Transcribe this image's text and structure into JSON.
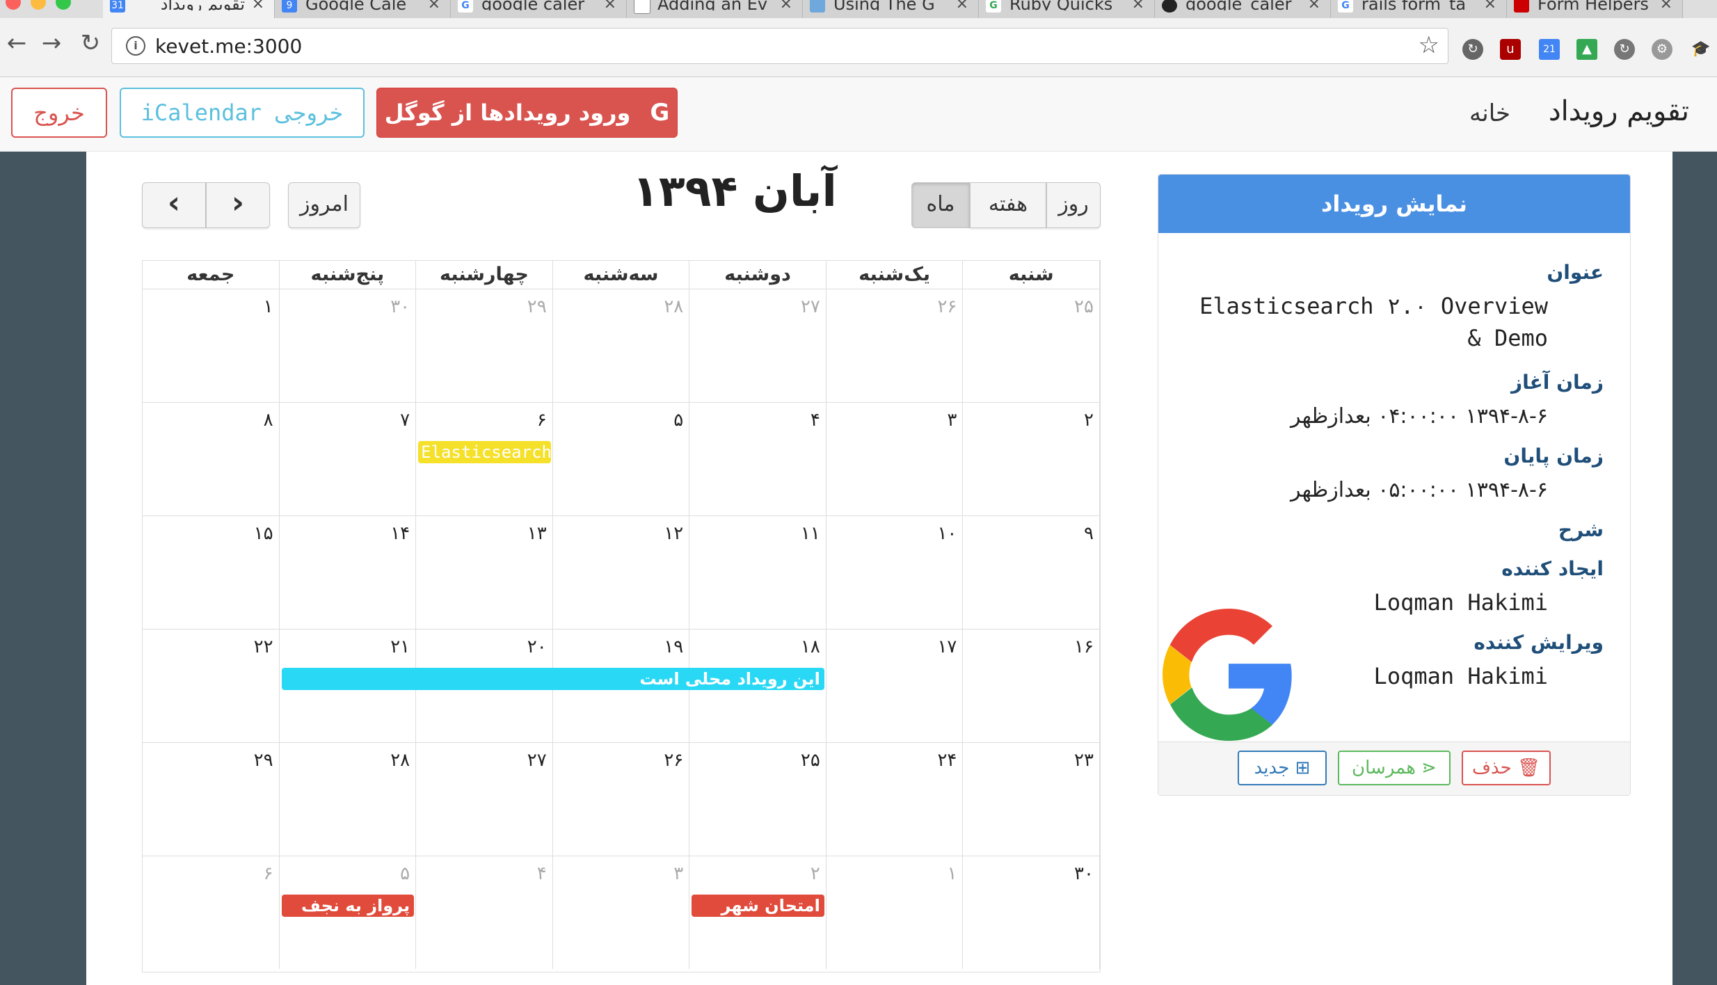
{
  "browser": {
    "tabs": [
      {
        "title": "تقویم رویداد",
        "favicon": "31",
        "color": "#4285f4",
        "active": true
      },
      {
        "title": "Google Cale",
        "favicon": "9",
        "color": "#4285f4"
      },
      {
        "title": "google caler",
        "favicon": "G",
        "color": "#4285f4"
      },
      {
        "title": "Adding an Ev",
        "favicon": "doc",
        "color": "#888888"
      },
      {
        "title": "Using The G",
        "favicon": "owl",
        "color": "#6fa8dc"
      },
      {
        "title": "Ruby Quicks",
        "favicon": "G",
        "color": "#34a853"
      },
      {
        "title": "google_caler",
        "favicon": "gh",
        "color": "#222222"
      },
      {
        "title": "rails form_ta",
        "favicon": "G",
        "color": "#4285f4"
      },
      {
        "title": "Form Helpers",
        "favicon": "rails",
        "color": "#cc0000"
      }
    ],
    "url": "kevet.me:3000"
  },
  "navbar": {
    "brand": "تقویم رویداد",
    "home": "خانه",
    "google_import": "ورود رویدادها از گوگل",
    "google_letter": "G",
    "icalendar_label": "خروجی",
    "icalendar_mono": "iCalendar",
    "logout": "خروج"
  },
  "calendar": {
    "title": "آبان ۱۳۹۴",
    "today": "امروز",
    "prev": "‹",
    "next": "›",
    "views": {
      "day": "روز",
      "week": "هفته",
      "month": "ماه"
    },
    "weekdays": [
      "شنبه",
      "یک‌شنبه",
      "دوشنبه",
      "سه‌شنبه",
      "چهارشنبه",
      "پنج‌شنبه",
      "جمعه"
    ],
    "weeks": [
      [
        "۲۵",
        "۲۶",
        "۲۷",
        "۲۸",
        "۲۹",
        "۳۰",
        "۱"
      ],
      [
        "۲",
        "۳",
        "۴",
        "۵",
        "۶",
        "۷",
        "۸"
      ],
      [
        "۹",
        "۱۰",
        "۱۱",
        "۱۲",
        "۱۳",
        "۱۴",
        "۱۵"
      ],
      [
        "۱۶",
        "۱۷",
        "۱۸",
        "۱۹",
        "۲۰",
        "۲۱",
        "۲۲"
      ],
      [
        "۲۳",
        "۲۴",
        "۲۵",
        "۲۶",
        "۲۷",
        "۲۸",
        "۲۹"
      ],
      [
        "۳۰",
        "۱",
        "۲",
        "۳",
        "۴",
        "۵",
        "۶"
      ]
    ],
    "events": [
      {
        "title": "Elasticsearch",
        "color": "#f5e02a"
      },
      {
        "title": "این رویداد محلی است",
        "color": "#29d8f5"
      },
      {
        "title": "امتحان شهر",
        "color": "#e04b3c"
      },
      {
        "title": "پرواز به نجف",
        "color": "#e04b3c"
      }
    ]
  },
  "panel": {
    "heading": "نمایش رویداد",
    "title_label": "عنوان",
    "title_line1": "Elasticsearch ۲.۰ Overview",
    "title_line2": "& Demo",
    "start_label": "زمان آغاز",
    "start_value": "۱۳۹۴-۸-۶ ۰۴:۰۰:۰۰ بعدازظهر",
    "end_label": "زمان پایان",
    "end_value": "۱۳۹۴-۸-۶ ۰۵:۰۰:۰۰ بعدازظهر",
    "description_label": "شرح",
    "creator_label": "ایجاد کننده",
    "creator_value": "Loqman Hakimi",
    "editor_label": "ویرایش کننده",
    "editor_value": "Loqman Hakimi",
    "delete": "حذف",
    "share": "همرسان",
    "new": "جدید"
  }
}
